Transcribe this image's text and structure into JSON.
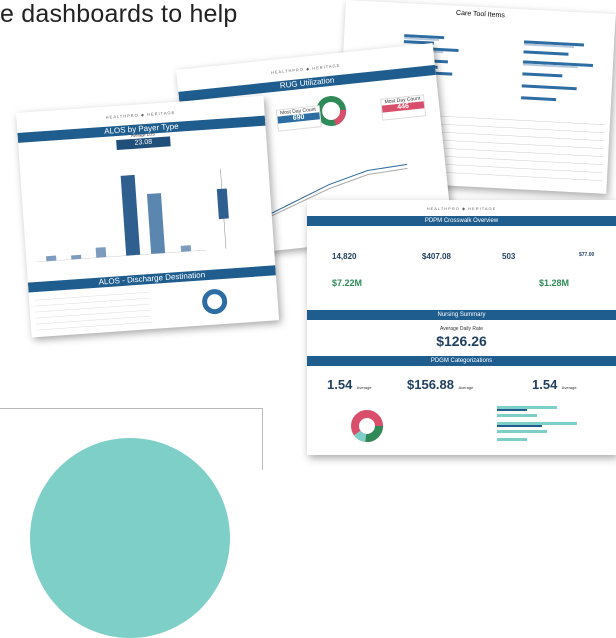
{
  "headline": "e dashboards to help",
  "care_tool": {
    "title": "Care Tool Items"
  },
  "rug": {
    "brand": "HEALTHPRO ◆ HERITAGE",
    "title": "RUG Utilization",
    "kpi1_label": "Most Day Count",
    "kpi1_value": "690",
    "kpi2_label": "Most Day Count",
    "kpi2_value": "446"
  },
  "alos": {
    "brand": "HEALTHPRO ◆ HERITAGE",
    "title": "ALOS by Payer Type",
    "avg_label": "Average LOS",
    "avg_value": "23.08",
    "discharge_title": "ALOS - Discharge Destination"
  },
  "pdpm": {
    "brand": "HEALTHPRO ◆ HERITAGE",
    "title": "PDPM Crosswalk Overview",
    "v1": "14,820",
    "v2": "$407.08",
    "v3": "503",
    "v4": "$77.00",
    "v5": "$7.22M",
    "v6": "$1.28M",
    "nursing_title": "Nursing Summary",
    "avg_daily_label": "Average Daily Rate",
    "avg_daily_value": "$126.26",
    "pdgm_title": "PDGM Categorizations",
    "n1": "1.54",
    "n2": "$156.88",
    "n3": "1.54",
    "avg_word": "Average"
  },
  "colors": {
    "accent": "#1f5d8f",
    "teal": "#7fcfc9"
  }
}
